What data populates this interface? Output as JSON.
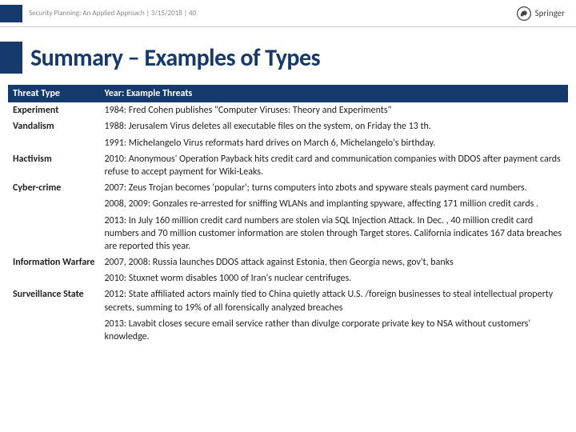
{
  "header": {
    "meta": "Security Planning: An Applied Approach | 3/15/2018 | 40",
    "brand": "Springer"
  },
  "title": "Summary – Examples of Types",
  "table": {
    "head": {
      "c0": "Threat Type",
      "c1": "Year: Example Threats"
    },
    "rows": [
      {
        "label": "Experiment",
        "text": "1984: Fred Cohen publishes \"Computer Viruses: Theory and Experiments\""
      },
      {
        "label": "Vandalism",
        "text": "1988: Jerusalem Virus deletes all executable files on the system, on Friday the 13 th."
      },
      {
        "label": "",
        "text": "1991: Michelangelo Virus reformats hard drives on March 6, Michelangelo's birthday."
      },
      {
        "label": "Hactivism",
        "text": "2010: Anonymous' Operation Payback hits credit card and communication companies with DDOS after payment cards refuse to accept payment for Wiki-Leaks."
      },
      {
        "label": "Cyber-crime",
        "text": "2007: Zeus Trojan becomes 'popular'; turns computers into zbots and spyware steals payment card numbers."
      },
      {
        "label": "",
        "text": "2008, 2009: Gonzales re-arrested for sniffing WLANs and implanting spyware, affecting 171 million credit cards ."
      },
      {
        "label": "",
        "text": "2013: In July 160 million credit card numbers are stolen via SQL Injection Attack.  In Dec. , 40 million credit card numbers and 70 million customer information are stolen through Target stores.  California indicates 167 data breaches are reported this year."
      },
      {
        "label": "Information Warfare",
        "text": "2007, 2008: Russia launches DDOS attack against Estonia, then Georgia news, gov't, banks"
      },
      {
        "label": "",
        "text": "2010: Stuxnet worm disables 1000 of Iran's nuclear centrifuges."
      },
      {
        "label": "Surveillance State",
        "text": "2012: State affiliated actors mainly tied to China quietly attack U.S. /foreign businesses to steal intellectual property secrets, summing to 19% of all forensically analyzed breaches"
      },
      {
        "label": "",
        "text": "2013: Lavabit closes secure email service rather than divulge corporate private key to NSA without customers' knowledge."
      }
    ]
  }
}
